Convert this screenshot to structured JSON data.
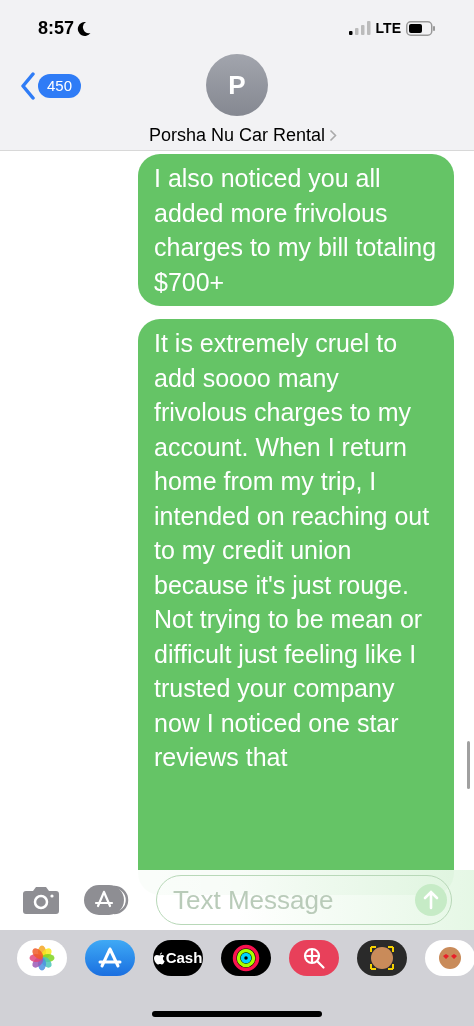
{
  "status_bar": {
    "time": "8:57",
    "network": "LTE"
  },
  "header": {
    "back_count": "450",
    "avatar_initial": "P",
    "contact_name": "Porsha Nu Car Rental"
  },
  "messages": [
    {
      "text": "I also noticed you all added more frivolous charges to my bill totaling $700+",
      "outgoing": true
    },
    {
      "text": "It is extremely cruel to add soooo many frivolous charges to my account. When I return home from my trip, I intended on reaching out to my credit union because it's just rouge. Not trying to be mean or difficult just feeling like I trusted your company now I noticed one star reviews that",
      "outgoing": true
    }
  ],
  "composer": {
    "placeholder": "Text Message"
  },
  "app_strip": [
    {
      "kind": "photos"
    },
    {
      "kind": "appstore"
    },
    {
      "kind": "cash",
      "label": "Cash"
    },
    {
      "kind": "activity"
    },
    {
      "kind": "search"
    },
    {
      "kind": "memoji"
    },
    {
      "kind": "memoji-stickers"
    }
  ]
}
